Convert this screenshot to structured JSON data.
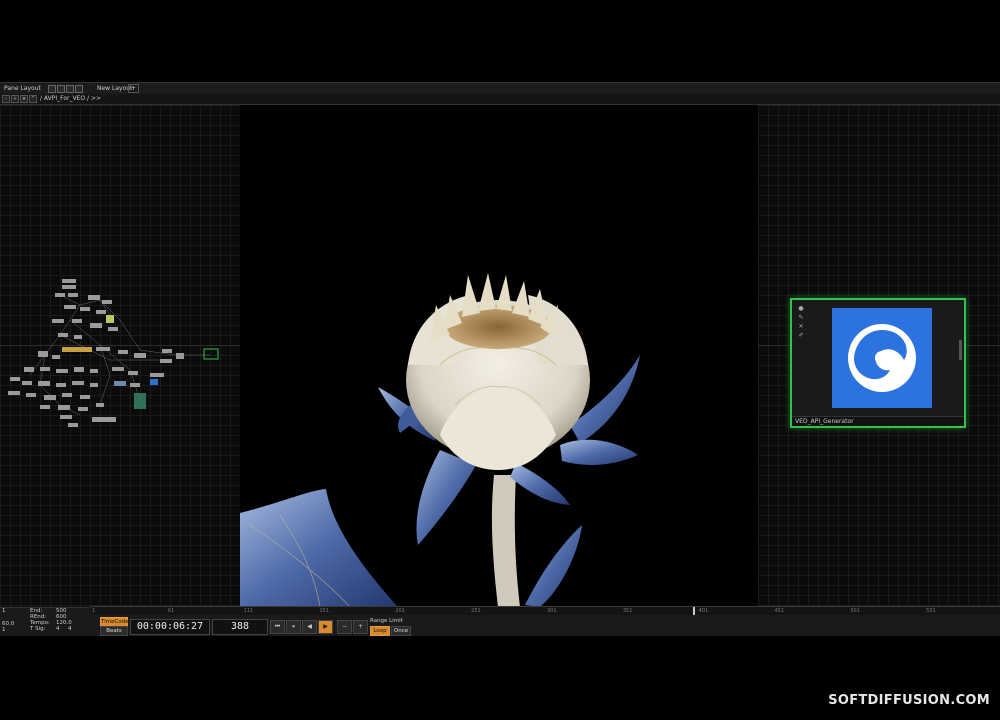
{
  "tabs": {
    "pane_layout": "Pane Layout",
    "new_layout": "New Layout",
    "add": "+"
  },
  "path": {
    "text": "/ AVPI_For_VEO / >>"
  },
  "node": {
    "name": "VEO_API_Generator",
    "accent_color": "#33c24a",
    "preview_color": "#2d73e0",
    "icon": "veo-logo-icon"
  },
  "ruler": {
    "ticks": [
      "1",
      "61",
      "111",
      "151",
      "201",
      "251",
      "301",
      "351",
      "401",
      "451",
      "501",
      "551"
    ]
  },
  "info": {
    "start": "1",
    "fps": "60.0",
    "sub": "1",
    "end_label": "End:",
    "end_value": "500",
    "rend_label": "REnd:",
    "rend_value": "600",
    "tempo_label": "Tempo:",
    "tempo_value": "120.0",
    "tsig_label": "T Sig:",
    "tsig_a": "4",
    "tsig_b": "4"
  },
  "transport": {
    "timecode_label": "TimeCode",
    "beats_label": "Beats",
    "timecode": "00:00:06:27",
    "frame": "388",
    "range_limit": "Range Limit",
    "loop": "Loop",
    "once": "Once",
    "buttons": [
      "⏮",
      "⏸",
      "◀",
      "▶",
      "−",
      "+"
    ]
  },
  "watermark": "SOFTDIFFUSION.COM"
}
